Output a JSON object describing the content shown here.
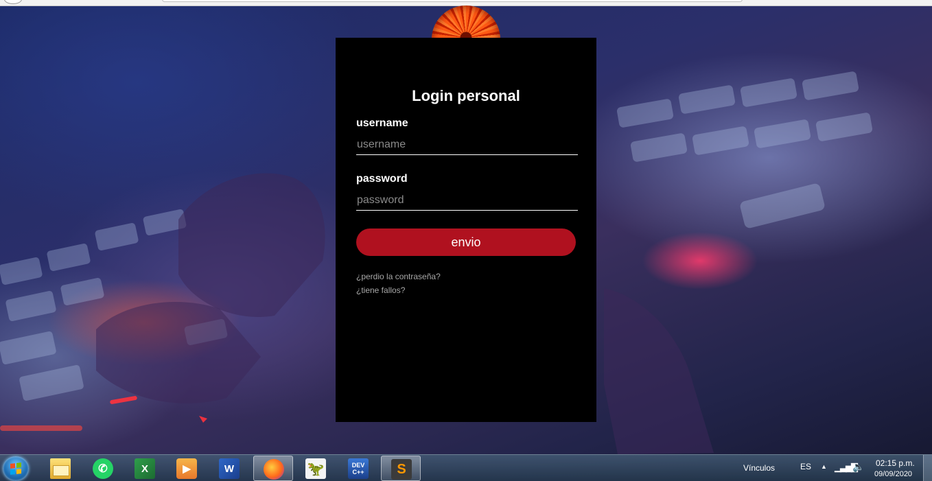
{
  "login": {
    "title": "Login personal",
    "username_label": "username",
    "username_placeholder": "username",
    "password_label": "password",
    "password_placeholder": "password",
    "submit_label": "envio",
    "forgot_link": "¿perdio la contraseña?",
    "issues_link": "¿tiene fallos?"
  },
  "taskbar": {
    "apps": [
      {
        "name": "Windows Explorer",
        "icon": "folder-icon"
      },
      {
        "name": "WhatsApp",
        "icon": "whatsapp-icon"
      },
      {
        "name": "Excel",
        "icon": "excel-icon",
        "glyph": "X"
      },
      {
        "name": "Media Player",
        "icon": "media-player-icon",
        "glyph": "▶"
      },
      {
        "name": "Word",
        "icon": "word-icon",
        "glyph": "W"
      },
      {
        "name": "Firefox",
        "icon": "firefox-icon"
      },
      {
        "name": "Dinosaur App",
        "icon": "dinosaur-icon",
        "glyph": "🦖"
      },
      {
        "name": "Dev-C++",
        "icon": "devcpp-icon",
        "glyph_top": "DEV",
        "glyph_bottom": "C++"
      },
      {
        "name": "Sublime Text",
        "icon": "sublime-text-icon",
        "glyph": "S"
      }
    ],
    "toolbar_label": "Vínculos",
    "language": "ES",
    "time": "02:15 p.m.",
    "date": "09/09/2020"
  },
  "colors": {
    "card_background": "#000000",
    "button_background": "#b0111f",
    "link_color": "#a8a8a8"
  }
}
